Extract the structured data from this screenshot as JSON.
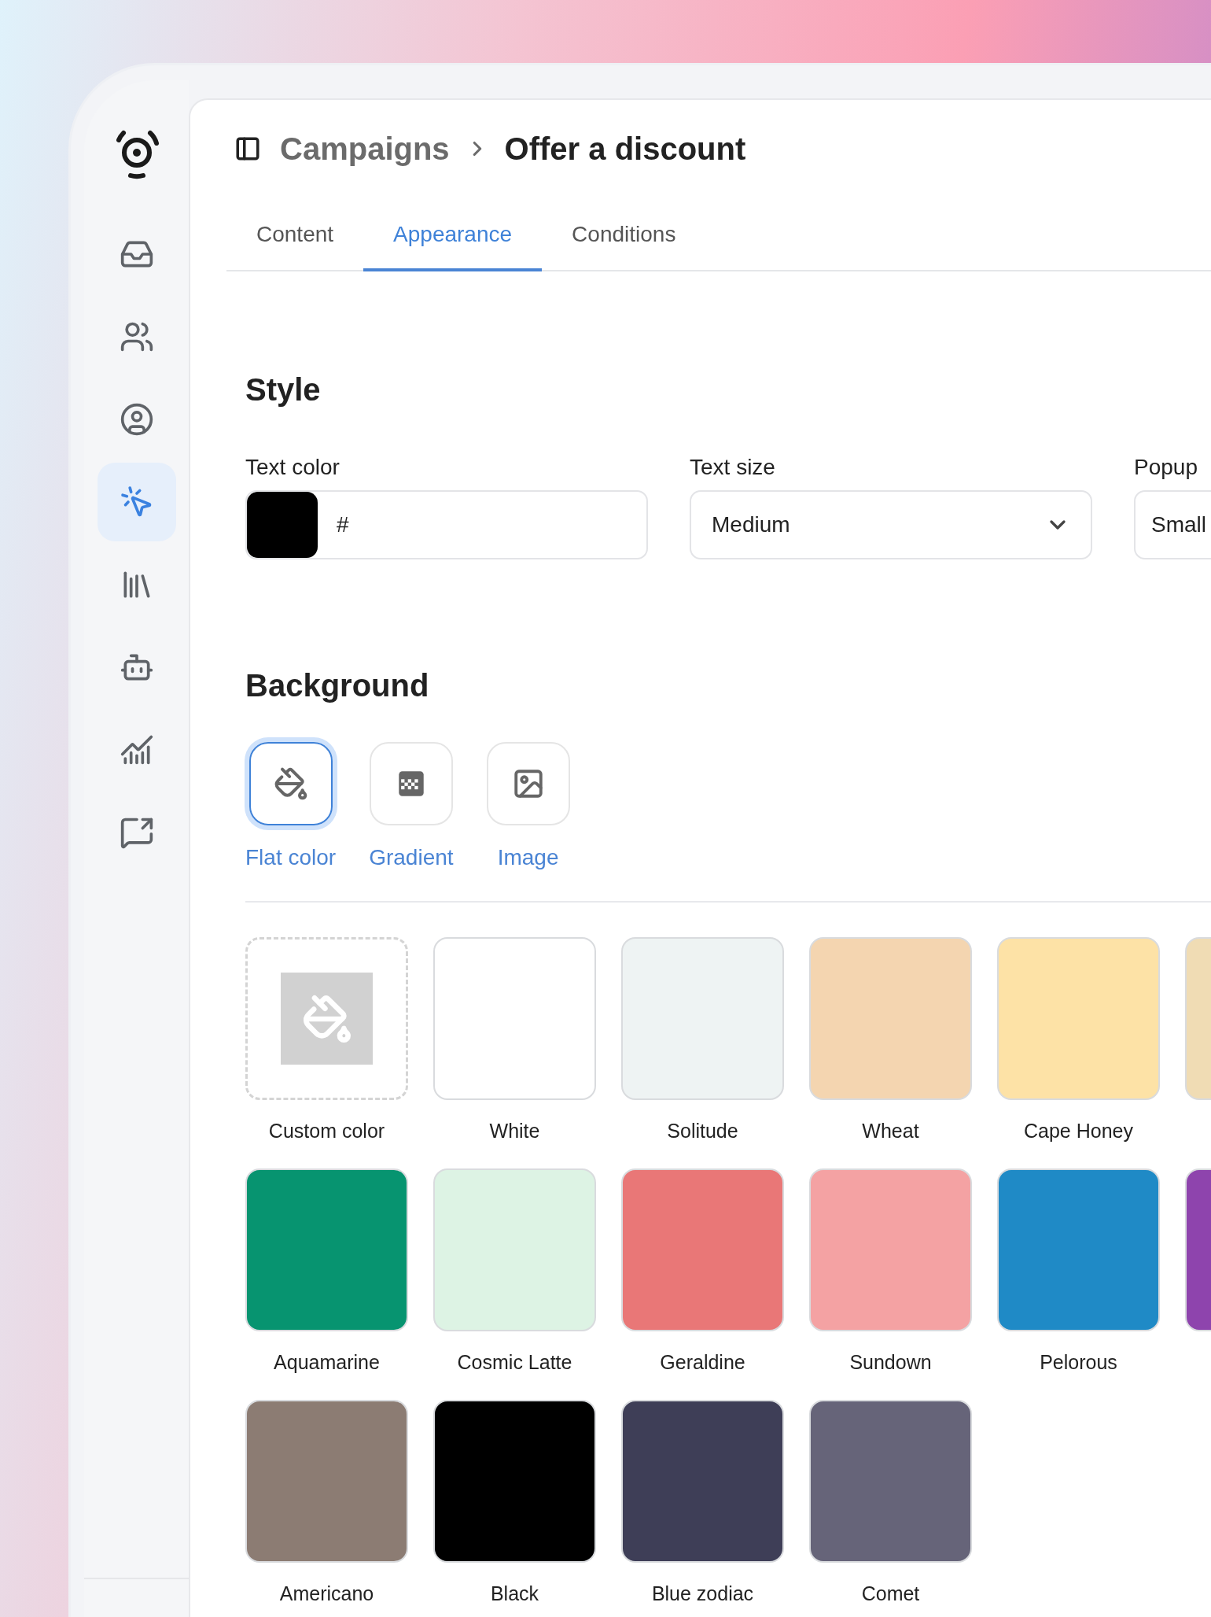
{
  "sidebar": {
    "items": [
      {
        "selected": false
      },
      {
        "selected": false
      },
      {
        "selected": false
      },
      {
        "selected": true
      },
      {
        "selected": false
      },
      {
        "selected": false
      },
      {
        "selected": false
      },
      {
        "selected": false
      }
    ]
  },
  "header": {
    "breadcrumb_parent": "Campaigns",
    "title": "Offer a discount"
  },
  "tabs": [
    {
      "label": "Content",
      "selected": false
    },
    {
      "label": "Appearance",
      "selected": true
    },
    {
      "label": "Conditions",
      "selected": false
    }
  ],
  "style": {
    "heading": "Style",
    "text_color": {
      "label": "Text color",
      "color": "#000000",
      "value": "#"
    },
    "text_size": {
      "label": "Text size",
      "value": "Medium"
    },
    "popup_size": {
      "label": "Popup",
      "value": "Small"
    }
  },
  "background": {
    "heading": "Background",
    "types": [
      {
        "label": "Flat color",
        "selected": true
      },
      {
        "label": "Gradient",
        "selected": false
      },
      {
        "label": "Image",
        "selected": false
      }
    ],
    "swatches": [
      {
        "kind": "custom",
        "name": "Custom color"
      },
      {
        "kind": "color",
        "name": "White",
        "color": "#ffffff"
      },
      {
        "kind": "color",
        "name": "Solitude",
        "color": "#eef3f3"
      },
      {
        "kind": "color",
        "name": "Wheat",
        "color": "#f4d5b0"
      },
      {
        "kind": "color",
        "name": "Cape Honey",
        "color": "#fde2a6"
      },
      {
        "kind": "color",
        "color": "#f0dcb4"
      },
      {
        "kind": "color",
        "name": "Aquamarine",
        "color": "#079470"
      },
      {
        "kind": "color",
        "name": "Cosmic Latte",
        "color": "#ddf3e4"
      },
      {
        "kind": "color",
        "name": "Geraldine",
        "color": "#e97777"
      },
      {
        "kind": "color",
        "name": "Sundown",
        "color": "#f4a2a3"
      },
      {
        "kind": "color",
        "name": "Pelorous",
        "color": "#1f8ac6"
      },
      {
        "kind": "color",
        "color": "#8e44ad"
      },
      {
        "kind": "color",
        "name": "Americano",
        "color": "#8c7c73"
      },
      {
        "kind": "color",
        "name": "Black",
        "color": "#000000"
      },
      {
        "kind": "color",
        "name": "Blue zodiac",
        "color": "#3e3e57"
      },
      {
        "kind": "color",
        "name": "Comet",
        "color": "#666479"
      }
    ]
  }
}
